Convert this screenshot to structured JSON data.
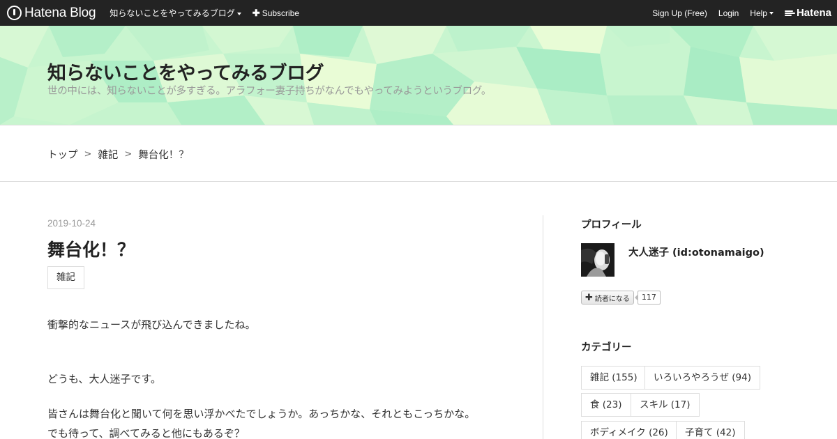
{
  "globalbar": {
    "logo_text": "Hatena Blog",
    "blog_menu": "知らないことをやってみるブログ",
    "subscribe": "Subscribe",
    "signup": "Sign Up (Free)",
    "login": "Login",
    "help": "Help",
    "hatena": "Hatena"
  },
  "header": {
    "title": "知らないことをやってみるブログ",
    "description": "世の中には、知らないことが多すぎる。アラフォー妻子持ちがなんでもやってみようというブログ。"
  },
  "breadcrumb": {
    "items": [
      "トップ",
      "雑記",
      "舞台化！？"
    ],
    "separator": ">"
  },
  "entry": {
    "date": "2019-10-24",
    "title": "舞台化！？",
    "category": "雑記",
    "paragraphs": [
      "衝撃的なニュースが飛び込んできましたね。",
      "どうも、大人迷子です。",
      "皆さんは舞台化と聞いて何を思い浮かべたでしょうか。あっちかな、それともこっちかな。",
      "でも待って、調べてみると他にもあるぞ？"
    ]
  },
  "sidebar": {
    "profile_heading": "プロフィール",
    "profile_name": "大人迷子 (id:otonamaigo)",
    "subscribe_label": "読者になる",
    "subscriber_count": "117",
    "category_heading": "カテゴリー",
    "categories": [
      "雑記 (155)",
      "いろいろやろうぜ (94)",
      "食 (23)",
      "スキル (17)",
      "ボディメイク (26)",
      "子育て (42)"
    ]
  },
  "colors": {
    "globalbar_bg": "#232323",
    "header_light": "#e8fcd6",
    "header_mid": "#c8f5cf",
    "header_dark": "#a9ecc4",
    "border": "#dddddd"
  }
}
